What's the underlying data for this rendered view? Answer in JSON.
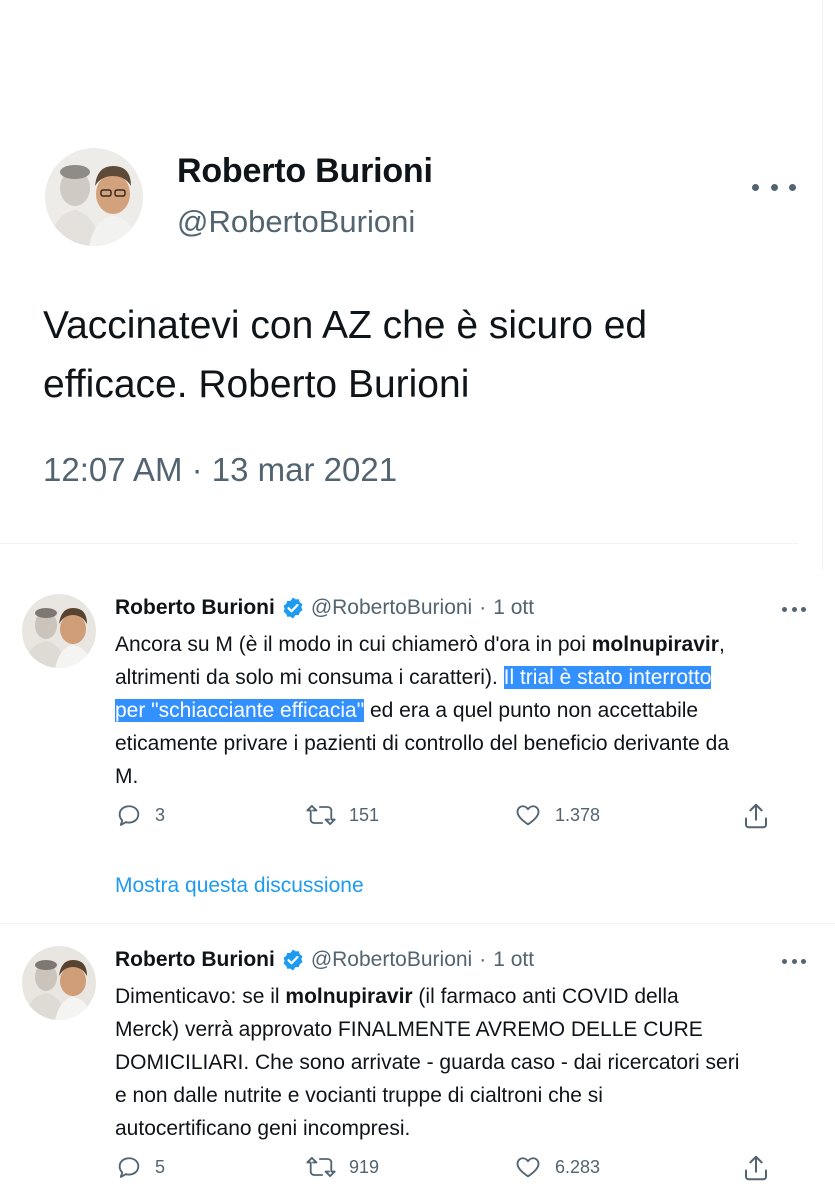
{
  "top_tweet": {
    "name": "Roberto Burioni",
    "handle": "@RobertoBurioni",
    "text_line1": "Vaccinatevi con AZ che è sicuro ed",
    "text_line2": "efficace. Roberto Burioni",
    "timestamp": "12:07 AM · 13 mar 2021",
    "more_icon": "more-horizontal-icon"
  },
  "tweets": [
    {
      "name": "Roberto Burioni",
      "handle": "@RobertoBurioni",
      "dot": "·",
      "date": "1 ott",
      "verified_color": "#1d9bf0",
      "text": {
        "p1": "Ancora su M (è il modo in cui chiamerò d'ora in poi ",
        "bold1": "molnupiravir",
        "p2": ",",
        "p3": "altrimenti da solo mi consuma i caratteri). ",
        "highlight1": "Il trial  è stato interrotto",
        "highlight2": "per \"schiacciante efficacia\"",
        "p4": " ed era a quel punto non accettabile",
        "p5": "eticamente privare i pazienti di controllo del beneficio derivante da",
        "p6": "M."
      },
      "replies": "3",
      "retweets": "151",
      "likes": "1.378",
      "show_thread": "Mostra questa discussione"
    },
    {
      "name": "Roberto Burioni",
      "handle": "@RobertoBurioni",
      "dot": "·",
      "date": "1 ott",
      "verified_color": "#1d9bf0",
      "text": {
        "p1": "Dimenticavo: se il ",
        "bold1": "molnupiravir",
        "p2": " (il farmaco anti COVID della",
        "p3": "Merck) verrà approvato FINALMENTE AVREMO DELLE CURE",
        "p4": "DOMICILIARI. Che sono arrivate - guarda caso - dai ricercatori seri",
        "p5": "e non dalle nutrite e vocianti truppe di cialtroni che si",
        "p6": "autocertificano geni incompresi."
      },
      "replies": "5",
      "retweets": "919",
      "likes": "6.283"
    }
  ],
  "colors": {
    "accent": "#1d9bf0",
    "highlight": "#3390ff",
    "secondary_text": "#536471"
  }
}
